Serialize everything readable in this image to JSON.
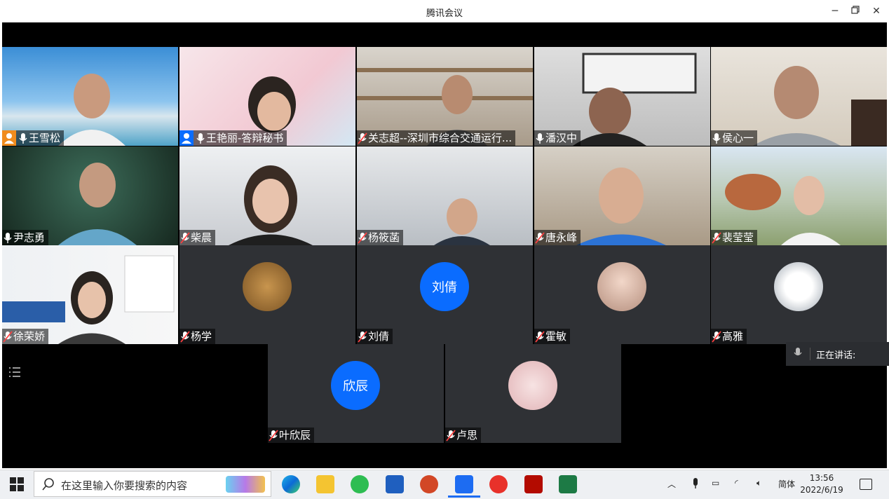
{
  "window": {
    "title": "腾讯会议"
  },
  "participants": [
    {
      "name": "王雪松",
      "host": true
    },
    {
      "name": "王艳丽-答辩秘书",
      "host": true
    },
    {
      "name": "关志超--深圳市综合交通运行..."
    },
    {
      "name": "潘汉中"
    },
    {
      "name": "侯心一"
    },
    {
      "name": "尹志勇"
    },
    {
      "name": "柴晨"
    },
    {
      "name": "杨筱菡"
    },
    {
      "name": "唐永峰"
    },
    {
      "name": "裴莹莹"
    },
    {
      "name": "徐荣娇"
    },
    {
      "name": "杨学"
    },
    {
      "name": "刘倩",
      "avatar_text": "刘倩"
    },
    {
      "name": "霍敏"
    },
    {
      "name": "高雅"
    },
    {
      "name": "叶欣辰",
      "avatar_text": "欣辰"
    },
    {
      "name": "卢思"
    }
  ],
  "speaking_panel": {
    "label": "正在讲话:"
  },
  "taskbar": {
    "search_placeholder": "在这里输入你要搜索的内容",
    "ime": "简体",
    "time": "13:56",
    "date": "2022/6/19"
  },
  "colors": {
    "accent": "#0a6cff",
    "host_badge": "#f08c1e",
    "tile_dark": "#2f3135"
  }
}
